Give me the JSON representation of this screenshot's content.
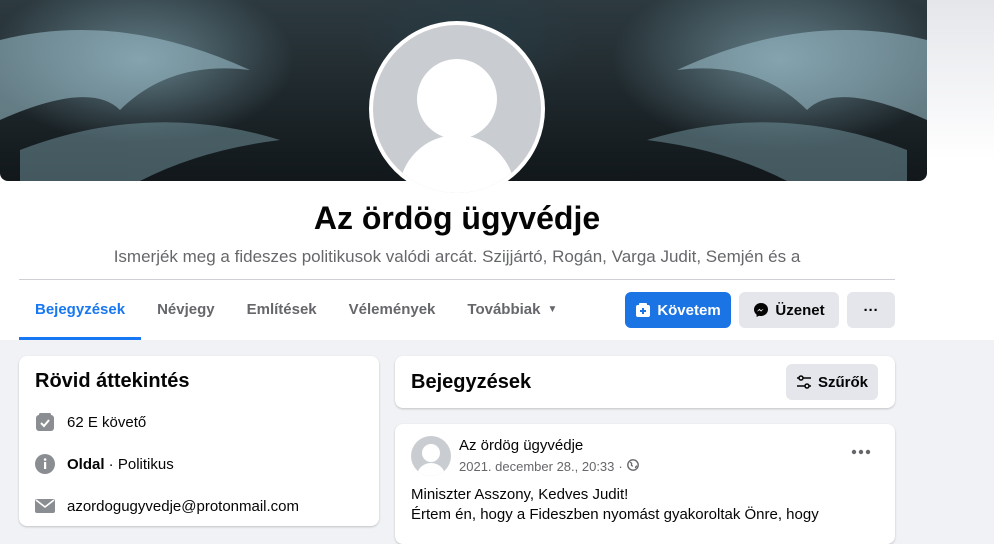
{
  "page": {
    "name": "Az ördög ügyvédje",
    "description": "Ismerjék meg a fideszes politikusok valódi arcát. Szijjártó, Rogán, Varga Judit, Semjén és a"
  },
  "tabs": [
    {
      "label": "Bejegyzések",
      "active": true
    },
    {
      "label": "Névjegy"
    },
    {
      "label": "Említések"
    },
    {
      "label": "Vélemények"
    },
    {
      "label": "Továbbiak",
      "dropdown": true
    }
  ],
  "actions": {
    "follow_label": "Követem",
    "message_label": "Üzenet",
    "more_label": "···"
  },
  "intro": {
    "title": "Rövid áttekintés",
    "followers": "62 E követő",
    "type_strong": "Oldal",
    "type_rest": " · Politikus",
    "email": "azordogugyvedje@protonmail.com"
  },
  "posts_header": {
    "title": "Bejegyzések",
    "filter_label": "Szűrők"
  },
  "post": {
    "author": "Az ördög ügyvédje",
    "date": "2021. december 28., 20:33",
    "separator": "·",
    "audience_icon": "globe-icon",
    "text_line1": "Miniszter Asszony, Kedves Judit!",
    "text_line2": "Értem én, hogy a Fideszben nyomást gyakoroltak Önre, hogy"
  },
  "colors": {
    "accent": "#1b74e4",
    "active_tab": "#1877f2",
    "secondary_text": "#65676b",
    "button_gray": "#e4e6eb"
  }
}
